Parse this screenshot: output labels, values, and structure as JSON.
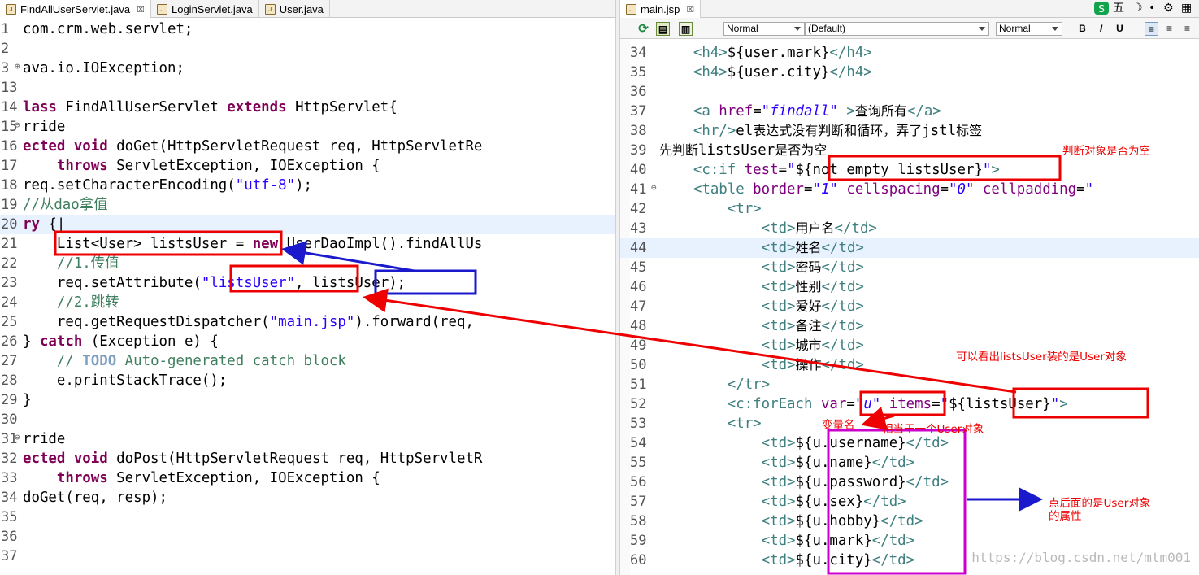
{
  "left_editor": {
    "tabs": [
      {
        "label": "FindAllUserServlet.java",
        "close": "☒",
        "active": true
      },
      {
        "label": "LoginServlet.java",
        "active": false
      },
      {
        "label": "User.java",
        "active": false
      }
    ],
    "lines": [
      {
        "num": "1",
        "segs": [
          [
            "el",
            "com.crm.web.servlet;"
          ]
        ]
      },
      {
        "num": "2",
        "segs": []
      },
      {
        "num": "3",
        "segs": [
          [
            "el",
            "ava.io.IOException;"
          ]
        ],
        "fold": "⊕"
      },
      {
        "num": "13",
        "segs": []
      },
      {
        "num": "14",
        "segs": [
          [
            "kw",
            "lass "
          ],
          [
            "el",
            "FindAllUserServlet "
          ],
          [
            "kw",
            "extends "
          ],
          [
            "el",
            "HttpServlet{"
          ]
        ]
      },
      {
        "num": "15",
        "segs": [
          [
            "el",
            "rride"
          ]
        ],
        "fold": "⊖"
      },
      {
        "num": "16",
        "segs": [
          [
            "kw",
            "ected void "
          ],
          [
            "el",
            "doGet(HttpServletRequest req, HttpServletRe"
          ]
        ]
      },
      {
        "num": "17",
        "segs": [
          [
            "kw",
            "    throws "
          ],
          [
            "el",
            "ServletException, IOException {"
          ]
        ]
      },
      {
        "num": "18",
        "segs": [
          [
            "el",
            "req.setCharacterEncoding("
          ],
          [
            "str",
            "\"utf-8\""
          ],
          [
            "el",
            ");"
          ]
        ]
      },
      {
        "num": "19",
        "segs": [
          [
            "cm",
            "//从dao拿值"
          ]
        ]
      },
      {
        "num": "20",
        "segs": [
          [
            "kw",
            "ry "
          ],
          [
            "el",
            "{|"
          ]
        ],
        "current": true
      },
      {
        "num": "21",
        "segs": [
          [
            "el",
            "    List<User> listsUser = "
          ],
          [
            "kw",
            "new "
          ],
          [
            "el",
            "UserDaoImpl().findAllUs"
          ]
        ]
      },
      {
        "num": "22",
        "segs": [
          [
            "cm",
            "    //1.传值"
          ]
        ]
      },
      {
        "num": "23",
        "segs": [
          [
            "el",
            "    req.setAttribute("
          ],
          [
            "str",
            "\"listsUser\""
          ],
          [
            "el",
            ", listsUser);"
          ]
        ]
      },
      {
        "num": "24",
        "segs": [
          [
            "cm",
            "    //2.跳转"
          ]
        ]
      },
      {
        "num": "25",
        "segs": [
          [
            "el",
            "    req.getRequestDispatcher("
          ],
          [
            "str",
            "\"main.jsp\""
          ],
          [
            "el",
            ").forward(req,"
          ]
        ]
      },
      {
        "num": "26",
        "segs": [
          [
            "el",
            "} "
          ],
          [
            "kw",
            "catch "
          ],
          [
            "el",
            "(Exception e) {"
          ]
        ]
      },
      {
        "num": "27",
        "segs": [
          [
            "cm",
            "    // "
          ],
          [
            "todo",
            "TODO "
          ],
          [
            "cm",
            "Auto-generated catch block"
          ]
        ]
      },
      {
        "num": "28",
        "segs": [
          [
            "el",
            "    e.printStackTrace();"
          ]
        ]
      },
      {
        "num": "29",
        "segs": [
          [
            "el",
            "}"
          ]
        ]
      },
      {
        "num": "30",
        "segs": []
      },
      {
        "num": "31",
        "segs": [
          [
            "el",
            "rride"
          ]
        ],
        "fold": "⊖"
      },
      {
        "num": "32",
        "segs": [
          [
            "kw",
            "ected void "
          ],
          [
            "el",
            "doPost(HttpServletRequest req, HttpServletR"
          ]
        ]
      },
      {
        "num": "33",
        "segs": [
          [
            "kw",
            "    throws "
          ],
          [
            "el",
            "ServletException, IOException {"
          ]
        ]
      },
      {
        "num": "34",
        "segs": [
          [
            "el",
            "doGet(req, resp);"
          ]
        ]
      },
      {
        "num": "35",
        "segs": []
      },
      {
        "num": "36",
        "segs": []
      },
      {
        "num": "37",
        "segs": []
      }
    ]
  },
  "right_editor": {
    "tab": {
      "label": "main.jsp",
      "close": "☒"
    },
    "toolbar": {
      "select1": "Normal",
      "select2": "(Default)",
      "select3": "Normal",
      "bold": "B",
      "italic": "I",
      "underline": "U"
    },
    "system_icons": {
      "ime": "五"
    },
    "lines": [
      {
        "num": "34",
        "segs": [
          [
            "tag",
            "    <h4>"
          ],
          [
            "el",
            "${user.mark}"
          ],
          [
            "tag",
            "</h4>"
          ]
        ]
      },
      {
        "num": "35",
        "segs": [
          [
            "tag",
            "    <h4>"
          ],
          [
            "el",
            "${user.city}"
          ],
          [
            "tag",
            "</h4>"
          ]
        ]
      },
      {
        "num": "36",
        "segs": []
      },
      {
        "num": "37",
        "segs": [
          [
            "tag",
            "    <a "
          ],
          [
            "attr",
            "href"
          ],
          [
            "el",
            "="
          ],
          [
            "aval",
            "\"findall\""
          ],
          [
            "tag",
            " >"
          ],
          [
            "cn",
            "查询所有"
          ],
          [
            "tag",
            "</a>"
          ]
        ]
      },
      {
        "num": "38",
        "segs": [
          [
            "tag",
            "    <hr/>"
          ],
          [
            "el",
            "el"
          ],
          [
            "cn",
            "表达式没有判断和循环，弄了"
          ],
          [
            "el",
            "jstl"
          ],
          [
            "cn",
            "标签"
          ]
        ]
      },
      {
        "num": "39",
        "segs": [
          [
            "cn",
            "先判断"
          ],
          [
            "el",
            "listsUser"
          ],
          [
            "cn",
            "是否为空"
          ]
        ]
      },
      {
        "num": "40",
        "segs": [
          [
            "tag",
            "    <c:if "
          ],
          [
            "attr",
            "test"
          ],
          [
            "el",
            "="
          ],
          [
            "aval",
            "\""
          ],
          [
            "el",
            "${not empty listsUser}"
          ],
          [
            "aval",
            "\""
          ],
          [
            "tag",
            ">"
          ]
        ]
      },
      {
        "num": "41",
        "segs": [
          [
            "tag",
            "    <table "
          ],
          [
            "attr",
            "border"
          ],
          [
            "el",
            "="
          ],
          [
            "aval",
            "\"1\" "
          ],
          [
            "attr",
            "cellspacing"
          ],
          [
            "el",
            "="
          ],
          [
            "aval",
            "\"0\" "
          ],
          [
            "attr",
            "cellpadding"
          ],
          [
            "el",
            "="
          ],
          [
            "aval",
            "\""
          ]
        ],
        "fold": "⊖"
      },
      {
        "num": "42",
        "segs": [
          [
            "tag",
            "        <tr>"
          ]
        ]
      },
      {
        "num": "43",
        "segs": [
          [
            "tag",
            "            <td>"
          ],
          [
            "cn",
            "用户名"
          ],
          [
            "tag",
            "</td>"
          ]
        ]
      },
      {
        "num": "44",
        "segs": [
          [
            "tag",
            "            <td>"
          ],
          [
            "cn",
            "姓名"
          ],
          [
            "tag",
            "</td>"
          ]
        ],
        "current": true
      },
      {
        "num": "45",
        "segs": [
          [
            "tag",
            "            <td>"
          ],
          [
            "cn",
            "密码"
          ],
          [
            "tag",
            "</td>"
          ]
        ]
      },
      {
        "num": "46",
        "segs": [
          [
            "tag",
            "            <td>"
          ],
          [
            "cn",
            "性别"
          ],
          [
            "tag",
            "</td>"
          ]
        ]
      },
      {
        "num": "47",
        "segs": [
          [
            "tag",
            "            <td>"
          ],
          [
            "cn",
            "爱好"
          ],
          [
            "tag",
            "</td>"
          ]
        ]
      },
      {
        "num": "48",
        "segs": [
          [
            "tag",
            "            <td>"
          ],
          [
            "cn",
            "备注"
          ],
          [
            "tag",
            "</td>"
          ]
        ]
      },
      {
        "num": "49",
        "segs": [
          [
            "tag",
            "            <td>"
          ],
          [
            "cn",
            "城市"
          ],
          [
            "tag",
            "</td>"
          ]
        ]
      },
      {
        "num": "50",
        "segs": [
          [
            "tag",
            "            <td>"
          ],
          [
            "cn",
            "操作"
          ],
          [
            "tag",
            "</td>"
          ]
        ]
      },
      {
        "num": "51",
        "segs": [
          [
            "tag",
            "        </tr>"
          ]
        ]
      },
      {
        "num": "52",
        "segs": [
          [
            "tag",
            "        <c:forEach "
          ],
          [
            "attr",
            "var"
          ],
          [
            "el",
            "="
          ],
          [
            "aval",
            "\"u\" "
          ],
          [
            "attr",
            "items"
          ],
          [
            "el",
            "="
          ],
          [
            "aval",
            "\""
          ],
          [
            "el",
            "${listsUser}"
          ],
          [
            "aval",
            "\""
          ],
          [
            "tag",
            ">"
          ]
        ]
      },
      {
        "num": "53",
        "segs": [
          [
            "tag",
            "        <tr>"
          ]
        ]
      },
      {
        "num": "54",
        "segs": [
          [
            "tag",
            "            <td>"
          ],
          [
            "el",
            "${u.username}"
          ],
          [
            "tag",
            "</td>"
          ]
        ]
      },
      {
        "num": "55",
        "segs": [
          [
            "tag",
            "            <td>"
          ],
          [
            "el",
            "${u.name}"
          ],
          [
            "tag",
            "</td>"
          ]
        ]
      },
      {
        "num": "56",
        "segs": [
          [
            "tag",
            "            <td>"
          ],
          [
            "el",
            "${u.password}"
          ],
          [
            "tag",
            "</td>"
          ]
        ]
      },
      {
        "num": "57",
        "segs": [
          [
            "tag",
            "            <td>"
          ],
          [
            "el",
            "${u.sex}"
          ],
          [
            "tag",
            "</td>"
          ]
        ]
      },
      {
        "num": "58",
        "segs": [
          [
            "tag",
            "            <td>"
          ],
          [
            "el",
            "${u.hobby}"
          ],
          [
            "tag",
            "</td>"
          ]
        ]
      },
      {
        "num": "59",
        "segs": [
          [
            "tag",
            "            <td>"
          ],
          [
            "el",
            "${u.mark}"
          ],
          [
            "tag",
            "</td>"
          ]
        ]
      },
      {
        "num": "60",
        "segs": [
          [
            "tag",
            "            <td>"
          ],
          [
            "el",
            "${u.city}"
          ],
          [
            "tag",
            "</td>"
          ]
        ]
      }
    ]
  },
  "annotations": {
    "note_empty": "判断对象是否为空",
    "note_user_object": "可以看出listsUser装的是User对象",
    "note_var_name": "变量名",
    "note_equals_user": "相当于一个User对象",
    "note_props_1": "点后面的是User对象",
    "note_props_2": "的属性",
    "colors": {
      "red": "#ee0000",
      "blue": "#1a1acc",
      "magenta": "#cc00cc"
    }
  },
  "watermark": "https://blog.csdn.net/mtm001"
}
